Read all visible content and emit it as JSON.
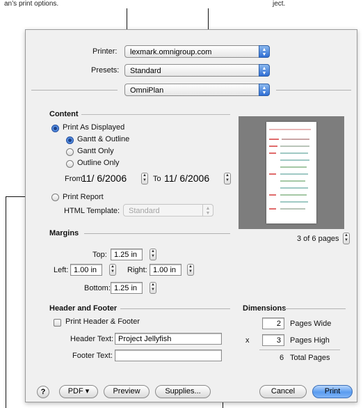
{
  "captions": {
    "top_left": "an’s print options.",
    "top_right": "ject."
  },
  "printer": {
    "label": "Printer:",
    "value": "lexmark.omnigroup.com"
  },
  "presets": {
    "label": "Presets:",
    "value": "Standard"
  },
  "panel": {
    "value": "OmniPlan"
  },
  "content": {
    "heading": "Content",
    "print_as_displayed": "Print As Displayed",
    "gantt_outline": "Gantt & Outline",
    "gantt_only": "Gantt Only",
    "outline_only": "Outline Only",
    "from_label": "From",
    "from_date": "11/ 6/2006",
    "to_label": "To",
    "to_date": "11/ 6/2006",
    "print_report": "Print Report",
    "html_template_label": "HTML Template:",
    "html_template_value": "Standard"
  },
  "preview": {
    "page_indicator": "3 of 6 pages"
  },
  "margins": {
    "heading": "Margins",
    "top_label": "Top:",
    "top_value": "1.25 in",
    "left_label": "Left:",
    "left_value": "1.00 in",
    "right_label": "Right:",
    "right_value": "1.00 in",
    "bottom_label": "Bottom:",
    "bottom_value": "1.25 in"
  },
  "header_footer": {
    "heading": "Header and Footer",
    "print_checkbox": "Print Header & Footer",
    "header_label": "Header Text:",
    "header_value": "Project Jellyfish",
    "footer_label": "Footer Text:",
    "footer_value": ""
  },
  "dimensions": {
    "heading": "Dimensions",
    "wide_value": "2",
    "wide_label": "Pages Wide",
    "times": "x",
    "high_value": "3",
    "high_label": "Pages High",
    "total_value": "6",
    "total_label": "Total Pages"
  },
  "buttons": {
    "help": "?",
    "pdf": "PDF ▾",
    "preview": "Preview",
    "supplies": "Supplies...",
    "cancel": "Cancel",
    "print": "Print"
  },
  "colors": {
    "accent": "#2f6ed4",
    "default_button": "#5a9cf0"
  }
}
